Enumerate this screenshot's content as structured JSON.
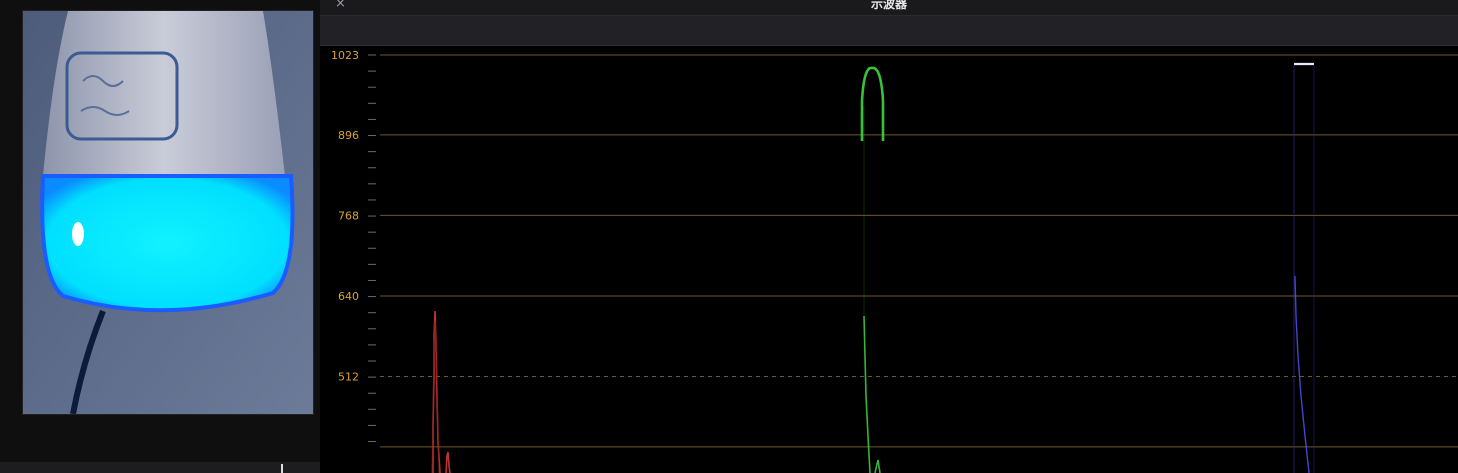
{
  "scope_window": {
    "title": "示波器",
    "close_glyph": "×"
  },
  "waveform": {
    "graticule_labels": [
      "1023",
      "896",
      "768",
      "640",
      "512"
    ],
    "graticule_values": [
      1023,
      896,
      768,
      640,
      512
    ],
    "visible_range": [
      384,
      1023
    ],
    "colors": {
      "label": "#d8a42e",
      "grid": "#6b5a2a",
      "red_trace": "#e23a3a",
      "green_trace": "#3fd63f",
      "blue_trace": "#5555ff"
    }
  },
  "icons": {
    "close": "close-icon"
  }
}
